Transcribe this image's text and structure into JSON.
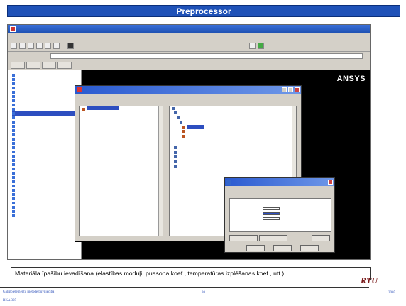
{
  "slide": {
    "title": "Preprocessor",
    "caption": "Materiāla īpašību ievadīšana (elastības moduļi, puasona koef., temperatūras izplēšanas koef., utt.)",
    "footer_left_line1": "Galīgo elementu metode būvniecībā",
    "footer_left_line2": "BKA 305",
    "page_number": "20",
    "year": "2005",
    "brand": "RTU"
  },
  "app": {
    "logo": "ANSYS"
  },
  "colors": {
    "title_bar": "#1f52b8",
    "window_blue": "#1c4fb0",
    "selection": "#2d4ec0",
    "graphics_bg": "#000000"
  },
  "icons": [
    "app-icon",
    "minimize-icon",
    "maximize-icon",
    "close-icon",
    "tree-node-icon",
    "material-icon"
  ]
}
